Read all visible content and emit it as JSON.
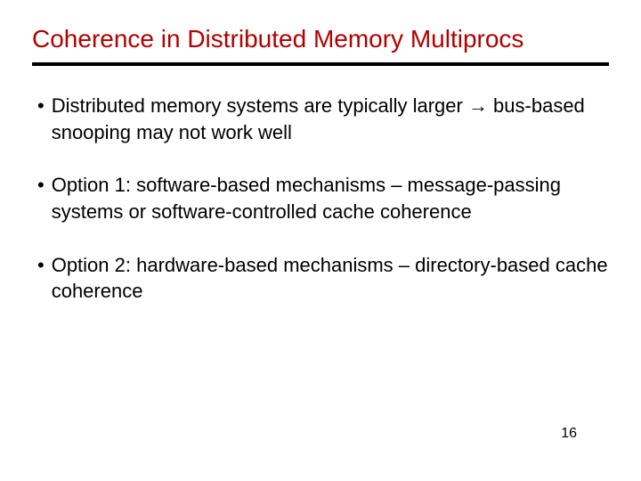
{
  "slide": {
    "title": "Coherence in Distributed Memory Multiprocs",
    "bullets": [
      "Distributed memory systems are typically larger → bus-based snooping may not work well",
      "Option 1: software-based mechanisms – message-passing systems or software-controlled cache coherence",
      "Option 2: hardware-based mechanisms – directory-based cache coherence"
    ],
    "page_number": "16"
  }
}
